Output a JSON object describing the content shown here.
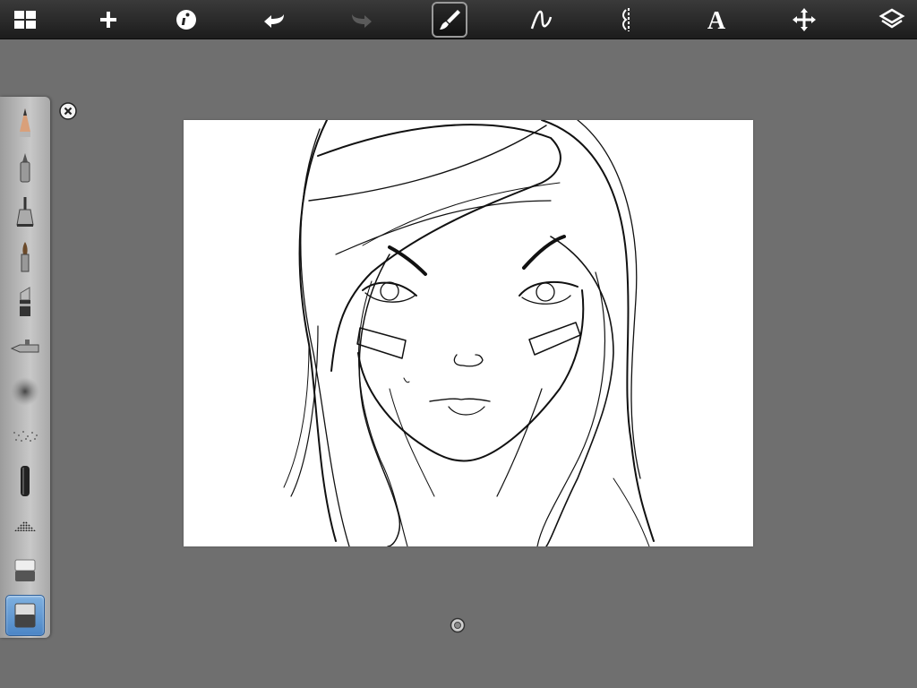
{
  "toolbar": {
    "items": [
      {
        "name": "gallery-icon"
      },
      {
        "name": "new-icon"
      },
      {
        "name": "info-icon"
      },
      {
        "name": "undo-icon"
      },
      {
        "name": "redo-icon"
      },
      {
        "name": "brush-icon",
        "active": true
      },
      {
        "name": "curve-icon"
      },
      {
        "name": "symmetry-icon"
      },
      {
        "name": "text-icon",
        "label": "A"
      },
      {
        "name": "transform-icon"
      },
      {
        "name": "layers-icon"
      }
    ]
  },
  "palette": {
    "tools": [
      "pencil",
      "ballpoint-pen",
      "marker",
      "paintbrush",
      "chisel-marker",
      "airbrush",
      "soft-airbrush",
      "dot-spray",
      "hard-brush",
      "halftone",
      "eraser",
      "soft-eraser"
    ],
    "selected_tool": "soft-eraser"
  },
  "colors": {
    "background": "#6f6f6f",
    "toolbar": "#222222",
    "canvas": "#ffffff",
    "selection": "#4c86c6"
  }
}
